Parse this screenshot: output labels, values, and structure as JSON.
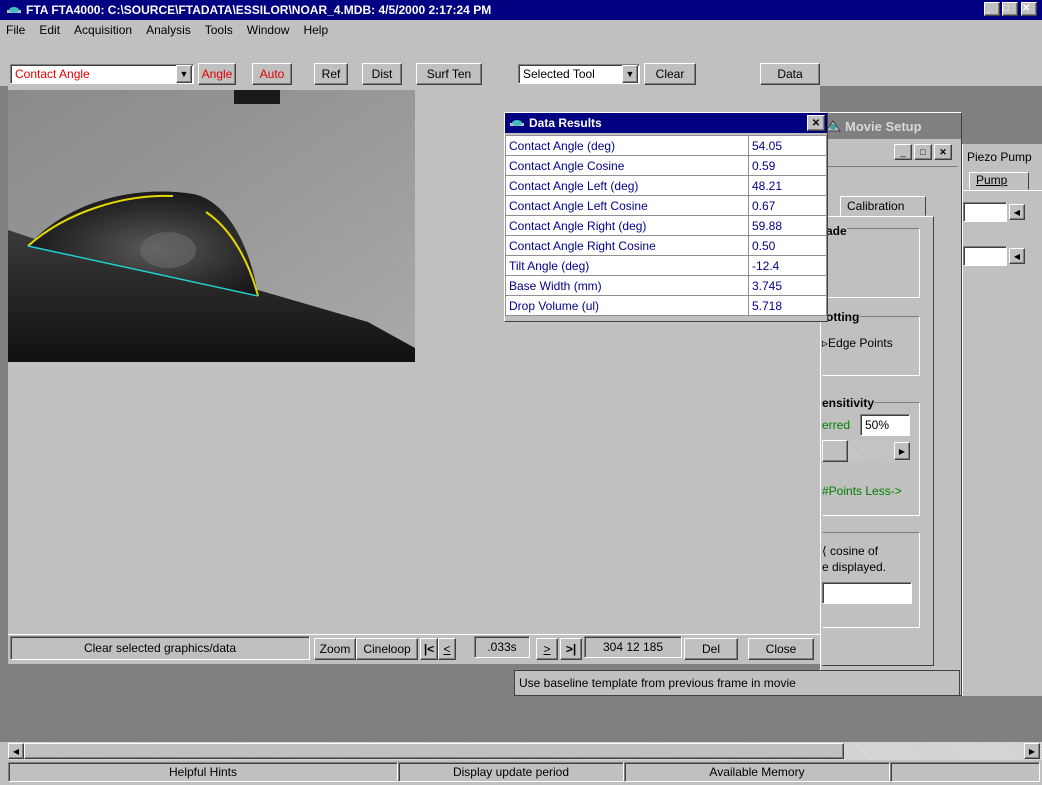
{
  "window": {
    "title": "FTA FTA4000: C:\\SOURCE\\FTADATA\\ESSILOR\\NOAR_4.MDB: 4/5/2000 2:17:24 PM",
    "min": "_",
    "max": "□",
    "close": "✕"
  },
  "menu": {
    "items": [
      "File",
      "Edit",
      "Acquisition",
      "Analysis",
      "Tools",
      "Window",
      "Help"
    ]
  },
  "toolbar": {
    "mode": "Contact Angle",
    "angle": "Angle",
    "auto": "Auto",
    "ref": "Ref",
    "dist": "Dist",
    "surften": "Surf Ten",
    "tool_select": "Selected Tool",
    "clear": "Clear",
    "data": "Data",
    "arrow": "▼"
  },
  "results": {
    "title": "Data Results",
    "close": "✕",
    "rows": [
      {
        "label": "Contact Angle (deg)",
        "value": "54.05"
      },
      {
        "label": "Contact Angle Cosine",
        "value": "0.59"
      },
      {
        "label": "Contact Angle Left (deg)",
        "value": "48.21"
      },
      {
        "label": "Contact Angle Left Cosine",
        "value": "0.67"
      },
      {
        "label": "Contact Angle Right (deg)",
        "value": "59.88"
      },
      {
        "label": "Contact Angle Right Cosine",
        "value": "0.50"
      },
      {
        "label": "Tilt Angle (deg)",
        "value": "-12.4"
      },
      {
        "label": "Base Width (mm)",
        "value": "3.745"
      },
      {
        "label": "Drop Volume (ul)",
        "value": "5.718"
      }
    ]
  },
  "movie": {
    "title": "Movie Setup",
    "tab_piezo": "Piezo Pump",
    "tab_pump": "Pump",
    "tab_calibration": "Calibration",
    "s1_title": "ade",
    "s2_title": "otting",
    "s2_text": "Edge Points",
    "s3_title": "ensitivity",
    "s3_label": "erred",
    "s3_value": "50%",
    "s3_hint": "#Points Less->",
    "s4_text1": "cosine of",
    "s4_text2": "e displayed.",
    "hint": "Use baseline template from previous frame in movie"
  },
  "controls": {
    "status": "Clear selected graphics/data",
    "zoom": "Zoom",
    "cineloop": "Cineloop",
    "first": "|<",
    "prev": "<",
    "interval": ".033s",
    "next": ">",
    "last": ">|",
    "coords": "304 12 185",
    "del": "Del",
    "close": "Close"
  },
  "statusbar": {
    "hints": "Helpful Hints",
    "update": "Display update period",
    "memory": "Available Memory"
  }
}
